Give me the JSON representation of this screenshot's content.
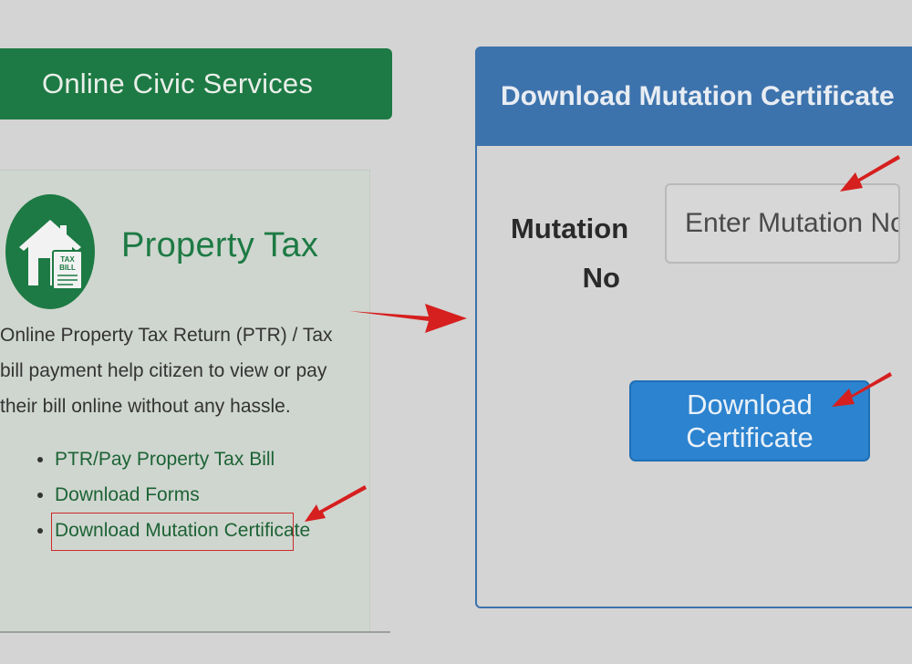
{
  "left": {
    "banner_title": "Online Civic Services",
    "section_title": "Property Tax",
    "house_icon_text": "TAX BILL",
    "description": "Online Property Tax Return (PTR) / Tax bill payment help citizen to view or pay their bill online without any hassle.",
    "links": [
      {
        "label": "PTR/Pay Property Tax Bill"
      },
      {
        "label": "Download Forms"
      },
      {
        "label": "Download Mutation Certificate"
      }
    ]
  },
  "right": {
    "panel_title": "Download Mutation Certificate",
    "mutation_label": "Mutation No",
    "mutation_placeholder": "Enter Mutation No..",
    "mutation_value": "",
    "download_button": "Download Certificate"
  },
  "colors": {
    "green": "#1d7a44",
    "blue_header": "#3d73ad",
    "blue_button": "#2c83cf",
    "annotation_red": "#d61f1f"
  },
  "icons": [
    "house-tax-icon",
    "arrow-icon"
  ]
}
